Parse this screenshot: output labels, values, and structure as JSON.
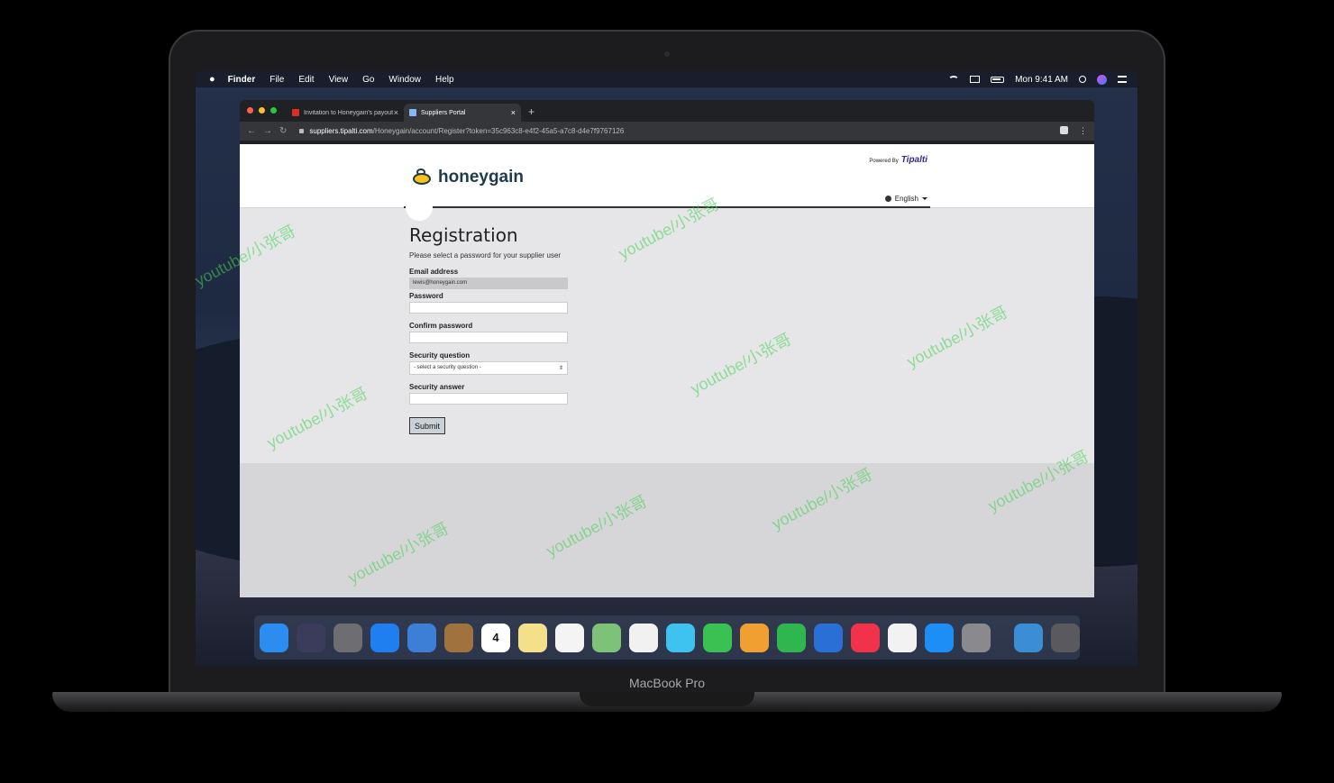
{
  "device": {
    "brand_label": "MacBook Pro"
  },
  "menubar": {
    "apple": "",
    "items": [
      "Finder",
      "File",
      "Edit",
      "View",
      "Go",
      "Window",
      "Help"
    ],
    "clock": "Mon 9:41 AM"
  },
  "browser": {
    "tabs": [
      {
        "title": "Invitation to Honeygain's payout",
        "close": "×"
      },
      {
        "title": "Suppliers Portal",
        "close": "×"
      }
    ],
    "new_tab": "+",
    "url_host": "suppliers.tipalti.com",
    "url_path": "/Honeygain/account/Register?token=35c963c8-e4f2-45a5-a7c8-d4e7f9767126"
  },
  "page": {
    "logo_text": "honeygain",
    "powered_by": "Powered By",
    "powered_brand": "Tipalti",
    "language": "English",
    "title": "Registration",
    "subtitle": "Please select a password for your supplier user",
    "email_label": "Email address",
    "email_value": "lewis@honeygain.com",
    "password_label": "Password",
    "confirm_label": "Confirm password",
    "question_label": "Security question",
    "question_placeholder": "- select a security question -",
    "answer_label": "Security answer",
    "submit_label": "Submit"
  },
  "dock": {
    "apps": [
      {
        "icon": "finder-icon",
        "color": "#2d8cf0"
      },
      {
        "icon": "siri-icon",
        "color": "#3b3b5c"
      },
      {
        "icon": "launchpad-icon",
        "color": "#6d6d72"
      },
      {
        "icon": "safari-icon",
        "color": "#1f7ff0"
      },
      {
        "icon": "mail-icon",
        "color": "#3d7fd6"
      },
      {
        "icon": "contacts-icon",
        "color": "#a0723e"
      },
      {
        "icon": "calendar-icon",
        "color": "#ffffff",
        "label": "4"
      },
      {
        "icon": "notes-icon",
        "color": "#f4e08a"
      },
      {
        "icon": "reminders-icon",
        "color": "#f4f4f4"
      },
      {
        "icon": "maps-icon",
        "color": "#7ec27a"
      },
      {
        "icon": "photos-icon",
        "color": "#f1f1f1"
      },
      {
        "icon": "messages-icon",
        "color": "#3ec3f0"
      },
      {
        "icon": "facetime-icon",
        "color": "#3ac154"
      },
      {
        "icon": "pages-icon",
        "color": "#f0a030"
      },
      {
        "icon": "numbers-icon",
        "color": "#2fb64e"
      },
      {
        "icon": "keynote-icon",
        "color": "#2a6fd6"
      },
      {
        "icon": "news-icon",
        "color": "#f0324a"
      },
      {
        "icon": "music-icon",
        "color": "#f2f2f2"
      },
      {
        "icon": "app-store-icon",
        "color": "#1c8ef5"
      },
      {
        "icon": "system-preferences-icon",
        "color": "#8a8a8e"
      },
      {
        "icon": "downloads-folder-icon",
        "color": "#3b8ed6"
      },
      {
        "icon": "trash-icon",
        "color": "#5a5a5e"
      }
    ]
  },
  "watermark": "youtube/小张哥",
  "colors": {
    "accent": "#1e3a4c",
    "bee": "#f7c21a"
  }
}
